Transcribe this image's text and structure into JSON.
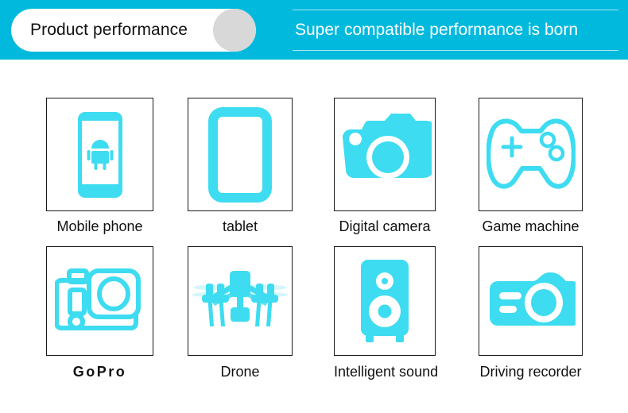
{
  "header": {
    "pill_title": "Product performance",
    "tagline": "Super compatible performance is born",
    "bar_color": "#00b9dd",
    "pill_bg": "#ffffff",
    "pill_circle_color": "#d8d8d8",
    "tagline_color": "#ffffff"
  },
  "theme": {
    "icon_color": "#3ddcf0",
    "box_border": "#1a1a1a",
    "label_color": "#111111",
    "page_bg": "#ffffff"
  },
  "grid": {
    "columns": 4,
    "rows": 2,
    "items": [
      {
        "id": "mobile-phone",
        "label": "Mobile phone",
        "icon": "smartphone-android-icon"
      },
      {
        "id": "tablet",
        "label": "tablet",
        "icon": "tablet-icon"
      },
      {
        "id": "digital-camera",
        "label": "Digital camera",
        "icon": "dslr-camera-icon"
      },
      {
        "id": "game-machine",
        "label": "Game machine",
        "icon": "gamepad-icon"
      },
      {
        "id": "gopro",
        "label": "GoPro",
        "icon": "action-camera-icon"
      },
      {
        "id": "drone",
        "label": "Drone",
        "icon": "quadcopter-drone-icon"
      },
      {
        "id": "intelligent-sound",
        "label": "Intelligent sound",
        "icon": "speaker-icon"
      },
      {
        "id": "driving-recorder",
        "label": "Driving recorder",
        "icon": "dashcam-icon"
      }
    ]
  }
}
